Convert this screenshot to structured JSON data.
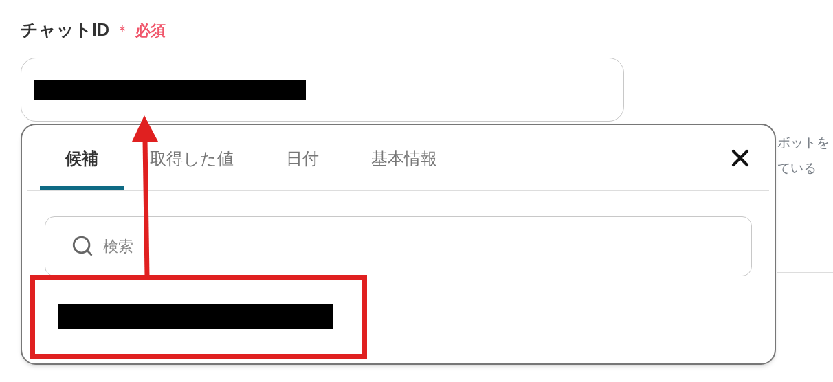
{
  "field": {
    "label": "チャットID",
    "required_mark": "＊",
    "required_text": "必須"
  },
  "background_text": [
    "ボットを",
    "ている"
  ],
  "popup": {
    "tabs": [
      {
        "label": "候補",
        "selected": true
      },
      {
        "label": "取得した値",
        "selected": false
      },
      {
        "label": "日付",
        "selected": false
      },
      {
        "label": "基本情報",
        "selected": false
      }
    ],
    "search": {
      "placeholder": "検索"
    }
  }
}
